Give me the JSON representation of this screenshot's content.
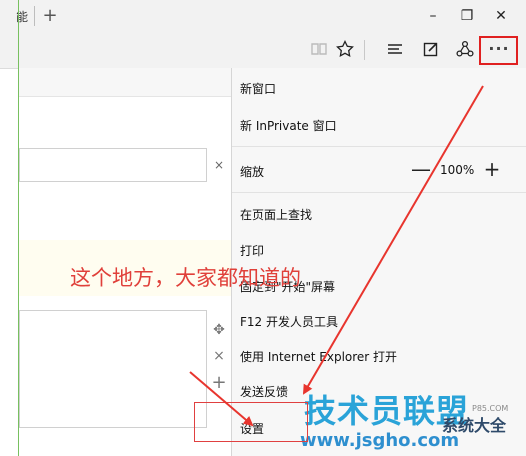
{
  "titlebar": {
    "tab_fragment": "能",
    "new_tab": "+",
    "minimize": "–",
    "restore": "❐",
    "close": "✕"
  },
  "toolbar": {
    "reading_view_icon": "book-icon",
    "favorite_icon": "star-icon",
    "hub_icon": "hub-icon",
    "web_note_icon": "pen-icon",
    "share_icon": "share-icon",
    "more_label": "···"
  },
  "page": {
    "clear_x": "×",
    "move_icon": "✥",
    "close_x": "×",
    "add": "+"
  },
  "menu": {
    "new_window": "新窗口",
    "new_inprivate": "新 InPrivate 窗口",
    "zoom_label": "缩放",
    "zoom_minus": "—",
    "zoom_value": "100%",
    "zoom_plus": "+",
    "find_on_page": "在页面上查找",
    "print": "打印",
    "pin_to_start": "固定到\"开始\"屏幕",
    "f12_tools": "F12 开发人员工具",
    "open_with_ie": "使用 Internet Explorer 打开",
    "send_feedback": "发送反馈",
    "settings": "设置"
  },
  "annotation": {
    "text": "这个地方，大家都知道的"
  },
  "watermark": {
    "main": "技术员联盟",
    "url": "www.jsgho.com",
    "side": "系统大全",
    "sub": "P85.COM"
  },
  "colors": {
    "annotation_red": "#e0403a",
    "watermark_blue": "#2aa3d8",
    "menu_bg": "#f7f7f7"
  }
}
